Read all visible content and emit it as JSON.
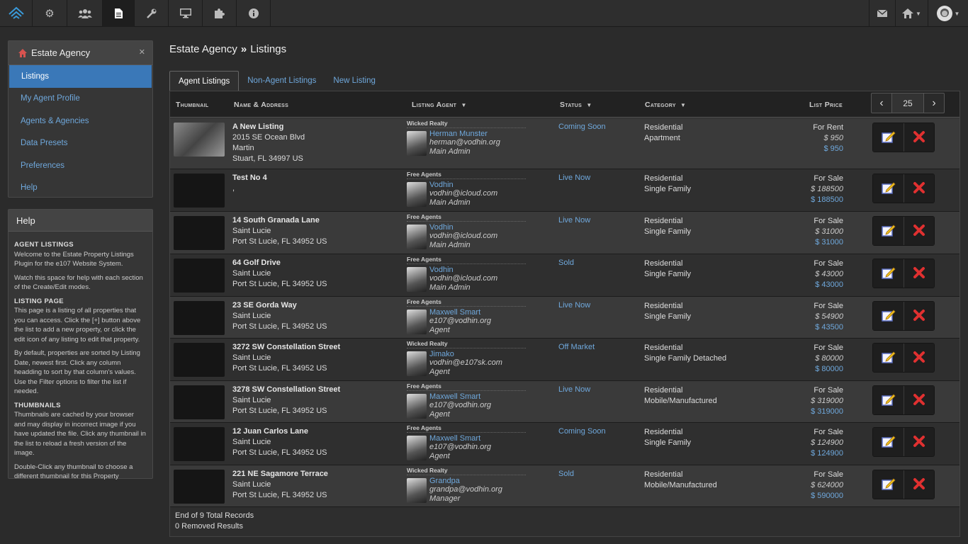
{
  "topbar": {
    "left_icons": [
      "logo-icon",
      "cogs-icon",
      "users-icon",
      "document-icon",
      "wrench-icon",
      "monitor-icon",
      "puzzle-icon",
      "info-icon"
    ],
    "right_icons": [
      "mail-icon",
      "home-icon",
      "avatar-icon"
    ]
  },
  "sidebar": {
    "title": "Estate Agency",
    "items": [
      "Listings",
      "My Agent Profile",
      "Agents & Agencies",
      "Data Presets",
      "Preferences",
      "Help"
    ],
    "active_index": 0
  },
  "help": {
    "title": "Help",
    "sections": [
      {
        "heading": "AGENT LISTINGS",
        "paras": [
          "Welcome to the Estate Property Listings Plugin for the e107 Website System.",
          "Watch this space for help with each section of the Create/Edit modes."
        ]
      },
      {
        "heading": "LISTING PAGE",
        "paras": [
          "This page is a listing of all properties that you can access. Click the [+] button above the list to add a new property, or click the edit icon of any listing to edit that property.",
          "By default, properties are sorted by Listing Date, newest first. Click any column headding to sort by that column's values. Use the Filter options to filter the list if needed."
        ]
      },
      {
        "heading": "THUMBNAILS",
        "paras": [
          "Thumbnails are cached by your browser and may display in incorrect image if you have updated the file. Click any thumbnail in the list to reload a fresh version of the image.",
          "Double-Click any thumbnail to choose a different thumbnail for this Property"
        ]
      }
    ]
  },
  "breadcrumb": {
    "parent": "Estate Agency",
    "sep": "»",
    "current": "Listings"
  },
  "tabs": [
    "Agent Listings",
    "Non-Agent Listings",
    "New Listing"
  ],
  "columns": {
    "thumb": "Thumbnail",
    "name": "Name & Address",
    "agent": "Listing Agent",
    "status": "Status",
    "category": "Category",
    "price": "List Price"
  },
  "pager": {
    "value": "25"
  },
  "rows": [
    {
      "name": "A New Listing",
      "addr": [
        "2015 SE Ocean Blvd",
        "Martin",
        "Stuart, FL 34997 US"
      ],
      "agency": "Wicked Realty",
      "agent": "Herman Munster",
      "email": "herman@vodhin.org",
      "role": "Main Admin",
      "status": "Coming Soon",
      "cat": [
        "Residential",
        "Apartment"
      ],
      "p1": "For Rent",
      "p2": "$ 950",
      "p3": "$ 950"
    },
    {
      "name": "Test No 4",
      "addr": [
        ","
      ],
      "agency": "Free Agents",
      "agent": "Vodhin",
      "email": "vodhin@icloud.com",
      "role": "Main Admin",
      "status": "Live Now",
      "cat": [
        "Residential",
        "Single Family"
      ],
      "p1": "For Sale",
      "p2": "$ 188500",
      "p3": "$ 188500"
    },
    {
      "name": "14 South Granada Lane",
      "addr": [
        "Saint Lucie",
        "Port St Lucie, FL 34952 US"
      ],
      "agency": "Free Agents",
      "agent": "Vodhin",
      "email": "vodhin@icloud.com",
      "role": "Main Admin",
      "status": "Live Now",
      "cat": [
        "Residential",
        "Single Family"
      ],
      "p1": "For Sale",
      "p2": "$ 31000",
      "p3": "$ 31000"
    },
    {
      "name": "64 Golf Drive",
      "addr": [
        "Saint Lucie",
        "Port St Lucie, FL 34952 US"
      ],
      "agency": "Free Agents",
      "agent": "Vodhin",
      "email": "vodhin@icloud.com",
      "role": "Main Admin",
      "status": "Sold",
      "cat": [
        "Residential",
        "Single Family"
      ],
      "p1": "For Sale",
      "p2": "$ 43000",
      "p3": "$ 43000"
    },
    {
      "name": "23 SE Gorda Way",
      "addr": [
        "Saint Lucie",
        "Port St Lucie, FL 34952 US"
      ],
      "agency": "Free Agents",
      "agent": "Maxwell Smart",
      "email": "e107@vodhin.org",
      "role": "Agent",
      "status": "Live Now",
      "cat": [
        "Residential",
        "Single Family"
      ],
      "p1": "For Sale",
      "p2": "$ 54900",
      "p3": "$ 43500"
    },
    {
      "name": "3272 SW Constellation Street",
      "addr": [
        "Saint Lucie",
        "Port St Lucie, FL 34952 US"
      ],
      "agency": "Wicked Realty",
      "agent": "Jimako",
      "email": "vodhin@e107sk.com",
      "role": "Agent",
      "status": "Off Market",
      "cat": [
        "Residential",
        "Single Family Detached"
      ],
      "p1": "For Sale",
      "p2": "$ 80000",
      "p3": "$ 80000"
    },
    {
      "name": "3278 SW Constellation Street",
      "addr": [
        "Saint Lucie",
        "Port St Lucie, FL 34952 US"
      ],
      "agency": "Free Agents",
      "agent": "Maxwell Smart",
      "email": "e107@vodhin.org",
      "role": "Agent",
      "status": "Live Now",
      "cat": [
        "Residential",
        "Mobile/Manufactured"
      ],
      "p1": "For Sale",
      "p2": "$ 319000",
      "p3": "$ 319000"
    },
    {
      "name": "12 Juan Carlos Lane",
      "addr": [
        "Saint Lucie",
        "Port St Lucie, FL 34952 US"
      ],
      "agency": "Free Agents",
      "agent": "Maxwell Smart",
      "email": "e107@vodhin.org",
      "role": "Agent",
      "status": "Coming Soon",
      "cat": [
        "Residential",
        "Single Family"
      ],
      "p1": "For Sale",
      "p2": "$ 124900",
      "p3": "$ 124900"
    },
    {
      "name": "221 NE Sagamore Terrace",
      "addr": [
        "Saint Lucie",
        "Port St Lucie, FL 34952 US"
      ],
      "agency": "Wicked Realty",
      "agent": "Grandpa",
      "email": "grandpa@vodhin.org",
      "role": "Manager",
      "status": "Sold",
      "cat": [
        "Residential",
        "Mobile/Manufactured"
      ],
      "p1": "For Sale",
      "p2": "$ 624000",
      "p3": "$ 590000"
    }
  ],
  "footer": {
    "total": "End of 9 Total Records",
    "removed": "0 Removed Results"
  }
}
